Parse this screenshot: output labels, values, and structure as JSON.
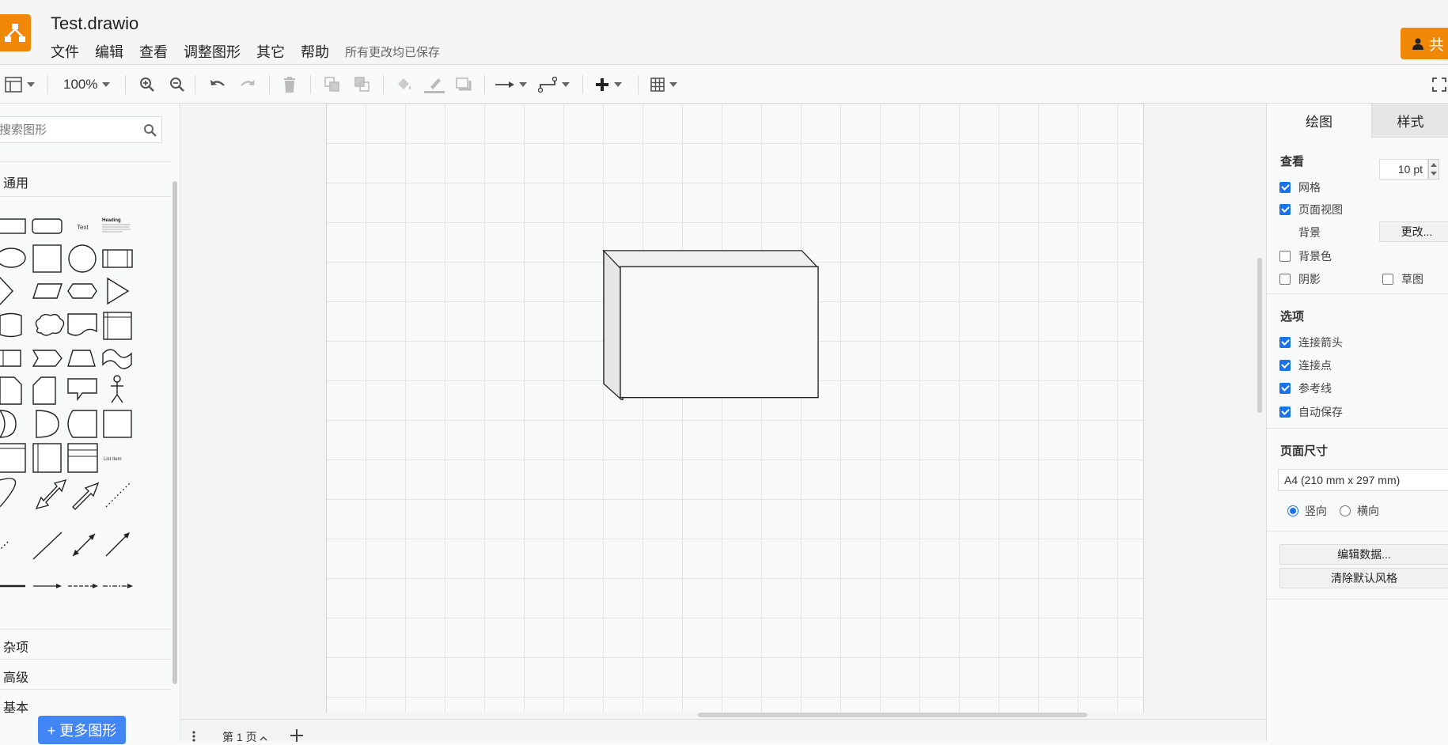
{
  "header": {
    "filename": "Test.drawio",
    "menu": [
      "文件",
      "编辑",
      "查看",
      "调整图形",
      "其它",
      "帮助"
    ],
    "saved_status": "所有更改均已保存",
    "share_label": "共"
  },
  "toolbar": {
    "zoom": "100%",
    "icons": [
      "format-panel-icon",
      "zoom-in-icon",
      "zoom-out-icon",
      "undo-icon",
      "redo-icon",
      "delete-icon",
      "to-front-icon",
      "to-back-icon",
      "fill-color-icon",
      "line-color-icon",
      "shadow-icon",
      "connection-icon",
      "waypoints-icon",
      "insert-icon",
      "table-icon",
      "fullscreen-icon"
    ]
  },
  "left_panel": {
    "search_placeholder": "搜索图形",
    "general_title": "通用",
    "sections": [
      "杂项",
      "高级",
      "基本"
    ],
    "more_shapes": "+ 更多图形",
    "text_shape": "Text",
    "heading_shape": "Heading",
    "list_item_shape": "List Item"
  },
  "bottom": {
    "page_tab": "第 1 页"
  },
  "right_panel": {
    "tab_draw": "绘图",
    "tab_style": "样式",
    "view_title": "查看",
    "grid_label": "网格",
    "grid_size": "10 pt",
    "page_view_label": "页面视图",
    "background_label": "背景",
    "change_button": "更改...",
    "bg_color_label": "背景色",
    "shadow_label": "阴影",
    "sketch_label": "草图",
    "options_title": "选项",
    "connect_arrows": "连接箭头",
    "connect_points": "连接点",
    "guides": "参考线",
    "autosave": "自动保存",
    "page_size_title": "页面尺寸",
    "page_size_value": "A4 (210 mm x 297 mm)",
    "portrait": "竖向",
    "landscape": "横向",
    "edit_data": "编辑数据...",
    "clear_style": "清除默认风格"
  },
  "colors": {
    "accent_orange": "#f08705",
    "accent_blue": "#4285f4",
    "checkbox_blue": "#1a73e8"
  }
}
